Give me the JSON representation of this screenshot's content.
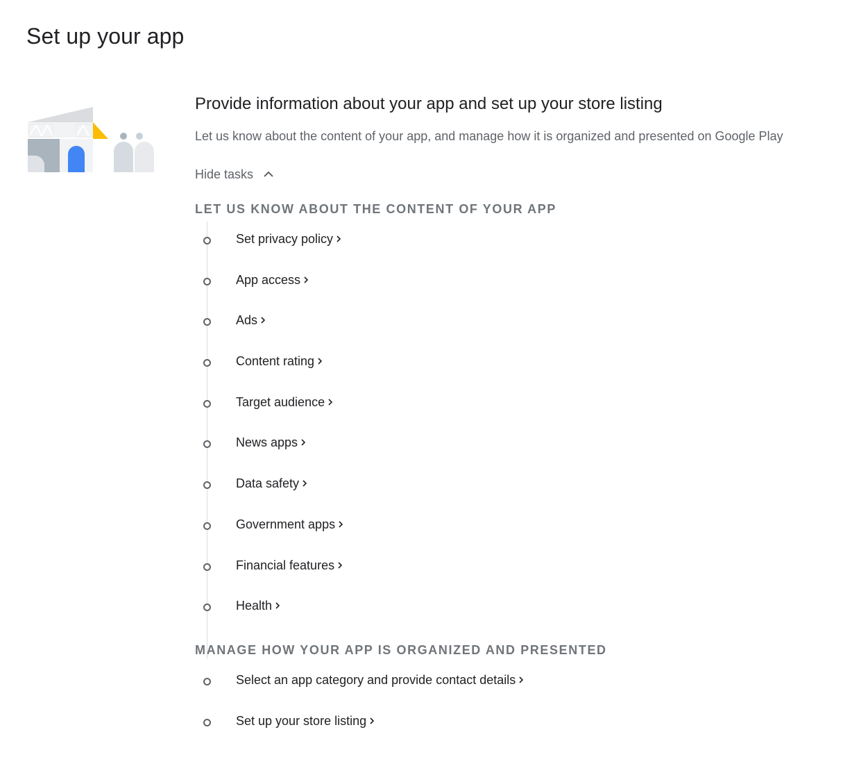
{
  "page": {
    "title": "Set up your app"
  },
  "section": {
    "title": "Provide information about your app and set up your store listing",
    "description": "Let us know about the content of your app, and manage how it is organized and presented on Google Play",
    "toggle_label": "Hide tasks"
  },
  "groups": [
    {
      "heading": "LET US KNOW ABOUT THE CONTENT OF YOUR APP",
      "tasks": [
        "Set privacy policy",
        "App access",
        "Ads",
        "Content rating",
        "Target audience",
        "News apps",
        "Data safety",
        "Government apps",
        "Financial features",
        "Health"
      ]
    },
    {
      "heading": "MANAGE HOW YOUR APP IS ORGANIZED AND PRESENTED",
      "tasks": [
        "Select an app category and provide contact details",
        "Set up your store listing"
      ]
    }
  ],
  "icons": {
    "toggle": "chevron-up-icon",
    "task_arrow": "chevron-right-icon",
    "task_status": "empty-circle-icon"
  },
  "colors": {
    "accent_blue": "#4285f4",
    "accent_yellow": "#fbbc04",
    "muted_text": "#5f6368",
    "heading_gray": "#70757a"
  }
}
